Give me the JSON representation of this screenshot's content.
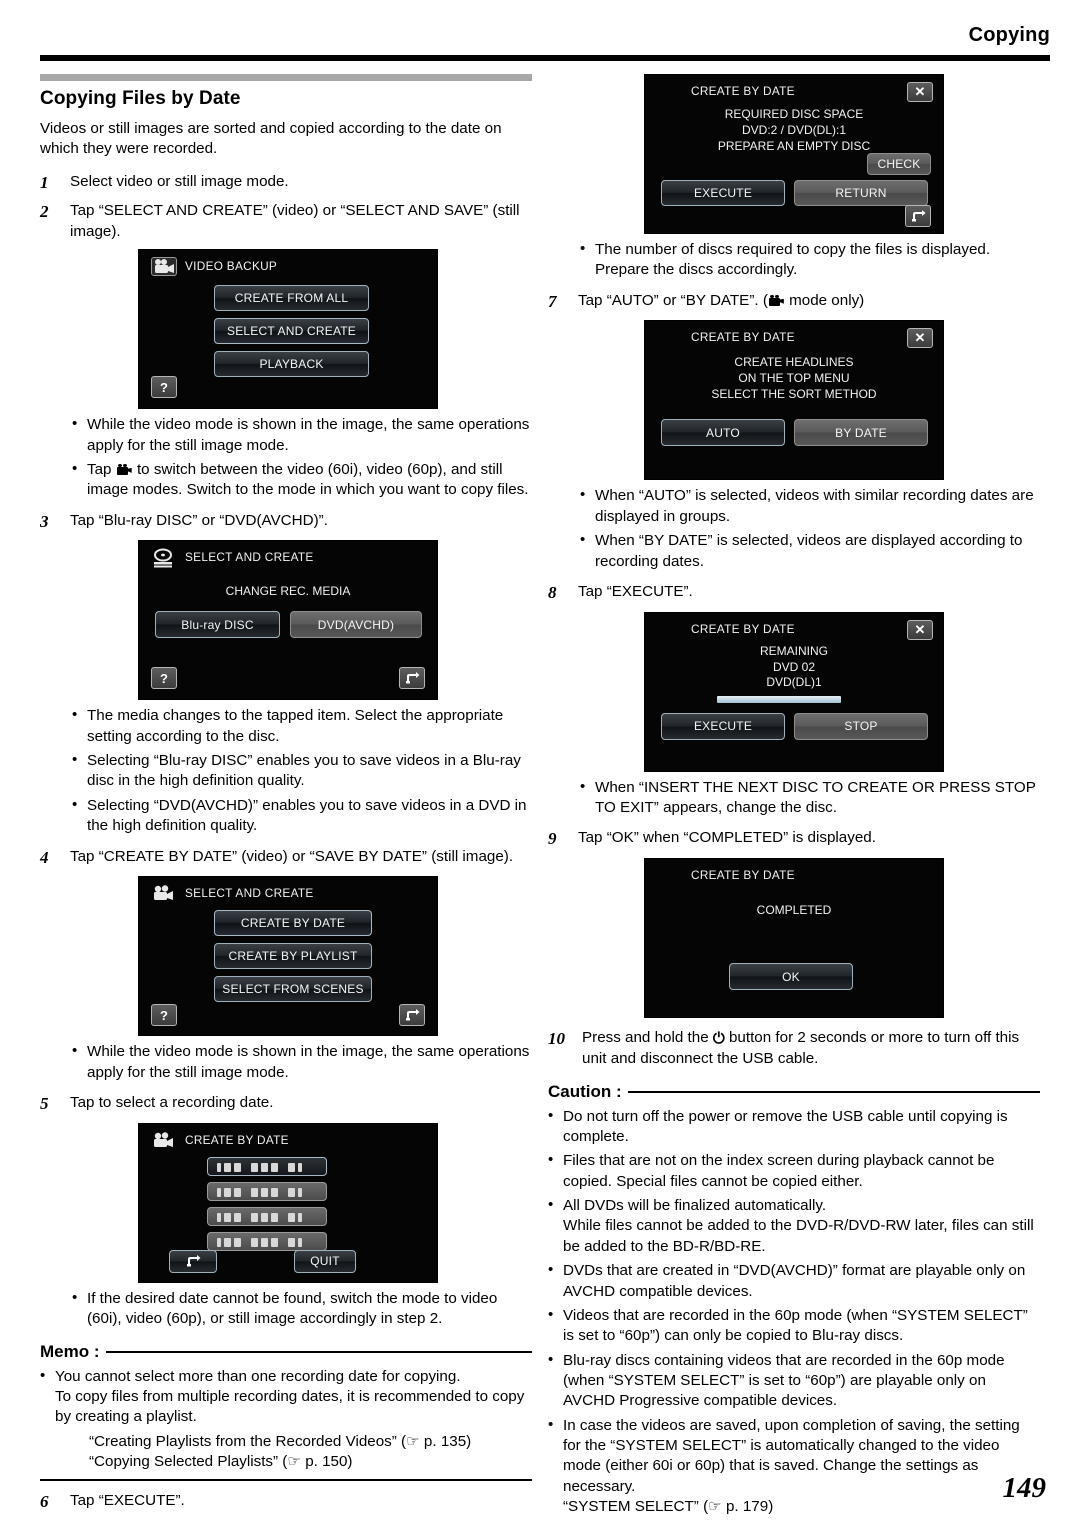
{
  "header": {
    "title": "Copying"
  },
  "page_number": "149",
  "left": {
    "section_title": "Copying Files by Date",
    "intro": "Videos or still images are sorted and copied according to the date on which they were recorded.",
    "step1": {
      "num": "1",
      "text": "Select video or still image mode."
    },
    "step2": {
      "num": "2",
      "text": "Tap “SELECT AND CREATE” (video) or “SELECT AND SAVE” (still image)."
    },
    "panel_video_backup": {
      "title": "VIDEO BACKUP",
      "icon": "video-camera-icon",
      "buttons": [
        "CREATE FROM ALL",
        "SELECT AND CREATE",
        "PLAYBACK"
      ],
      "selected": "SELECT AND CREATE",
      "help_button": "?"
    },
    "bullets_after_2": [
      "While the video mode is shown in the image, the same operations apply for the still image mode.",
      "Tap ■ to switch between the video (60i), video (60p), and still image modes. Switch to the mode in which you want to copy files."
    ],
    "bullet2_pre": "Tap ",
    "bullet2_post": " to switch between the video (60i), video (60p), and still image modes. Switch to the mode in which you want to copy files.",
    "step3": {
      "num": "3",
      "text": "Tap “Blu-ray DISC” or “DVD(AVCHD)”."
    },
    "panel_select_create_media": {
      "title": "SELECT AND CREATE",
      "icon": "disc-icon",
      "center_text": "CHANGE REC. MEDIA",
      "buttons": [
        "Blu-ray DISC",
        "DVD(AVCHD)"
      ],
      "selected": "Blu-ray DISC",
      "help_button": "?",
      "back_button": "back-arrow-icon"
    },
    "bullets_after_3": [
      "The media changes to the tapped item. Select the appropriate setting according to the disc.",
      "Selecting “Blu-ray DISC” enables you to save videos in a Blu-ray disc in the high definition quality.",
      "Selecting “DVD(AVCHD)” enables you to save videos in a DVD in the high definition quality."
    ],
    "step4": {
      "num": "4",
      "text": "Tap “CREATE BY DATE” (video) or “SAVE BY DATE” (still image)."
    },
    "panel_select_create": {
      "title": "SELECT AND CREATE",
      "icon": "video-camera-icon",
      "buttons": [
        "CREATE BY DATE",
        "CREATE BY PLAYLIST",
        "SELECT FROM SCENES"
      ],
      "selected": "CREATE BY DATE",
      "help_button": "?",
      "back_button": "back-arrow-icon"
    },
    "bullets_after_4": [
      "While the video mode is shown in the image, the same operations apply for the still image mode."
    ],
    "step5": {
      "num": "5",
      "text": "Tap to select a recording date."
    },
    "panel_create_by_date": {
      "title": "CREATE BY DATE",
      "icon": "video-camera-icon",
      "date_rows": [
        "date-row-1",
        "date-row-2",
        "date-row-3",
        "date-row-4"
      ],
      "selected_row": "date-row-1",
      "back_button": "back-arrow-icon",
      "quit_button": "QUIT"
    },
    "bullets_after_5": [
      "If the desired date cannot be found, switch the mode to video (60i), video (60p), or still image accordingly in step 2."
    ],
    "memo": {
      "label": "Memo :",
      "items": [
        "You cannot select more than one recording date for copying.\nTo copy files from multiple recording dates, it is recommended to copy by creating a playlist."
      ],
      "refs": [
        "“Creating Playlists from the Recorded Videos” (☞ p. 135)",
        "“Copying Selected Playlists” (☞ p. 150)"
      ]
    },
    "step6": {
      "num": "6",
      "text": "Tap “EXECUTE”."
    }
  },
  "right": {
    "panel_required_disc": {
      "title": "CREATE BY DATE",
      "close_button": "✕",
      "center_text": "REQUIRED DISC SPACE\nDVD:2 / DVD(DL):1\nPREPARE AN EMPTY DISC",
      "check_button": "CHECK",
      "buttons": [
        "EXECUTE",
        "RETURN"
      ],
      "selected": "EXECUTE",
      "back_button": "back-arrow-icon"
    },
    "bullets_after_6": [
      "The number of discs required to copy the files is displayed. Prepare the discs accordingly."
    ],
    "step7": {
      "num": "7",
      "pre": "Tap “AUTO” or “BY DATE”. (",
      "post": " mode only)"
    },
    "panel_sort_method": {
      "title": "CREATE BY DATE",
      "close_button": "✕",
      "center_text": "CREATE HEADLINES\nON THE TOP MENU\nSELECT THE SORT METHOD",
      "buttons": [
        "AUTO",
        "BY DATE"
      ],
      "selected": "AUTO"
    },
    "bullets_after_7": [
      "When “AUTO” is selected, videos with similar recording dates are displayed in groups.",
      "When “BY DATE” is selected, videos are displayed according to recording dates."
    ],
    "step8": {
      "num": "8",
      "text": "Tap “EXECUTE”."
    },
    "panel_remaining": {
      "title": "CREATE BY DATE",
      "close_button": "✕",
      "center_text": "REMAINING\nDVD   02\nDVD(DL)1",
      "progress": 100,
      "buttons": [
        "EXECUTE",
        "STOP"
      ],
      "selected": "EXECUTE"
    },
    "bullets_after_8": [
      "When “INSERT THE NEXT DISC TO CREATE OR PRESS STOP TO EXIT” appears, change the disc."
    ],
    "step9": {
      "num": "9",
      "text": "Tap “OK” when “COMPLETED” is displayed."
    },
    "panel_completed": {
      "title": "CREATE BY DATE",
      "center_text": "COMPLETED",
      "ok_button": "OK"
    },
    "step10": {
      "num": "10",
      "pre": "Press and hold the ",
      "post": " button for 2 seconds or more to turn off this unit and disconnect the USB cable."
    },
    "caution": {
      "label": "Caution :",
      "items": [
        "Do not turn off the power or remove the USB cable until copying is complete.",
        "Files that are not on the index screen during playback cannot be copied. Special files cannot be copied either.",
        "All DVDs will be finalized automatically.\nWhile files cannot be added to the DVD-R/DVD-RW later, files can still be added to the BD-R/BD-RE.",
        "DVDs that are created in “DVD(AVCHD)” format are playable only on AVCHD compatible devices.",
        "Videos that are recorded in the 60p mode (when “SYSTEM SELECT” is set to “60p”) can only be copied to Blu-ray discs.",
        "Blu-ray discs containing videos that are recorded in the 60p mode (when “SYSTEM SELECT” is set to “60p”) are playable only on AVCHD Progressive compatible devices.",
        "In case the videos are saved, upon completion of saving, the setting for the “SYSTEM SELECT” is automatically changed to the video mode (either 60i or 60p) that is saved. Change the settings as necessary.\n“SYSTEM SELECT” (☞ p. 179)"
      ]
    }
  }
}
